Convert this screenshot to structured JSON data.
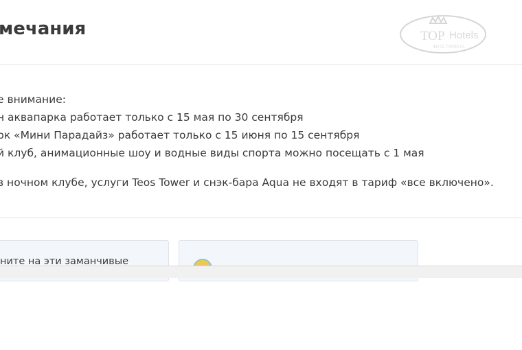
{
  "section": {
    "title": "мечания"
  },
  "watermark": {
    "brand_top": "TOP",
    "brand_hotels": "Hotels",
    "brand_sub": "ФОТО ТУРИСТА"
  },
  "notes": {
    "intro": "е внимание:",
    "items": [
      "н аквапарка работает только с 15 мая по 30 сентября",
      "рк «Мини Парадайз» работает только с 15 июня по 15 сентября",
      "й клуб, анимационные шоу и водные виды спорта можно посещать с 1 мая"
    ],
    "extra": " в ночном клубе, услуги Teos Tower и снэк-бара Aqua не входят в тариф «все включено»."
  },
  "cards": {
    "left_text": "ните на эти заманчивые",
    "right_icon": "smiley-icon"
  },
  "colors": {
    "card_bg": "#f3f6fb",
    "card_border": "#dbe3ee",
    "divider": "#e3e3e3",
    "text": "#3b3b3b"
  }
}
